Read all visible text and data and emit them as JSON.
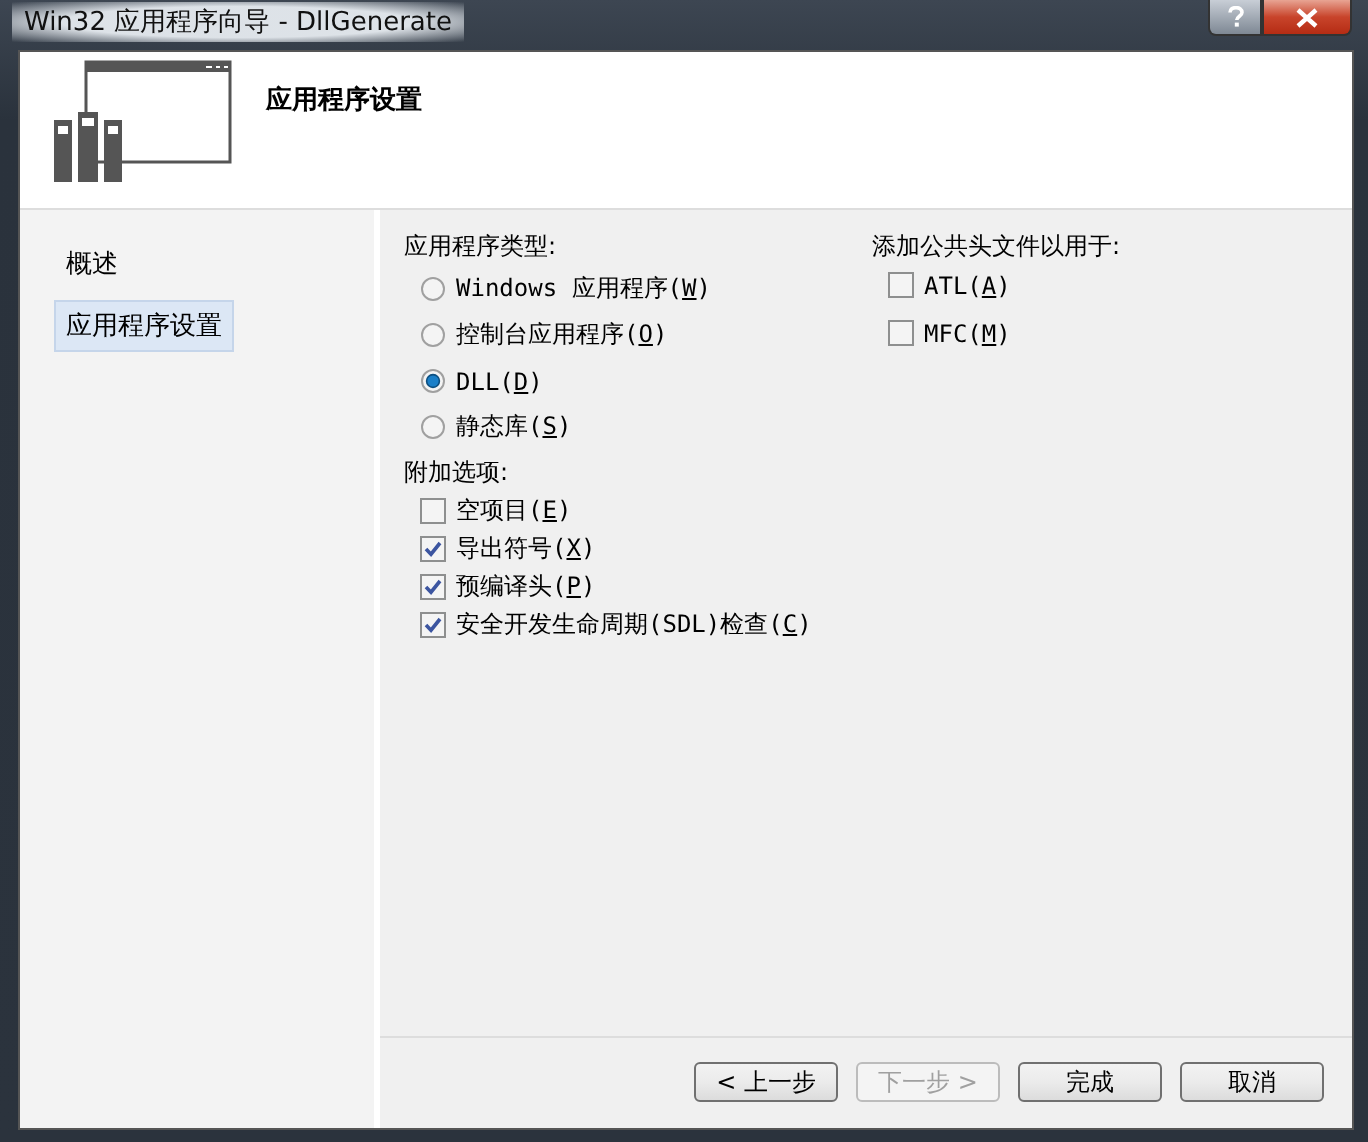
{
  "window": {
    "title": "Win32 应用程序向导 - DllGenerate"
  },
  "header": {
    "title": "应用程序设置"
  },
  "sidebar": {
    "items": [
      {
        "label": "概述",
        "selected": false
      },
      {
        "label": "应用程序设置",
        "selected": true
      }
    ]
  },
  "application_type": {
    "label": "应用程序类型:",
    "options": [
      {
        "label": "Windows 应用程序(W)",
        "selected": false
      },
      {
        "label": "控制台应用程序(O)",
        "selected": false
      },
      {
        "label": "DLL(D)",
        "selected": true
      },
      {
        "label": "静态库(S)",
        "selected": false
      }
    ]
  },
  "additional_options": {
    "label": "附加选项:",
    "options": [
      {
        "label": "空项目(E)",
        "checked": false
      },
      {
        "label": "导出符号(X)",
        "checked": true
      },
      {
        "label": "预编译头(P)",
        "checked": true
      },
      {
        "label": "安全开发生命周期(SDL)检查(C)",
        "checked": true
      }
    ]
  },
  "common_headers": {
    "label": "添加公共头文件以用于:",
    "options": [
      {
        "label": "ATL(A)",
        "checked": false
      },
      {
        "label": "MFC(M)",
        "checked": false
      }
    ]
  },
  "buttons": [
    {
      "label": "< 上一步",
      "disabled": false
    },
    {
      "label": "下一步 >",
      "disabled": true
    },
    {
      "label": "完成",
      "disabled": false
    },
    {
      "label": "取消",
      "disabled": false
    }
  ]
}
